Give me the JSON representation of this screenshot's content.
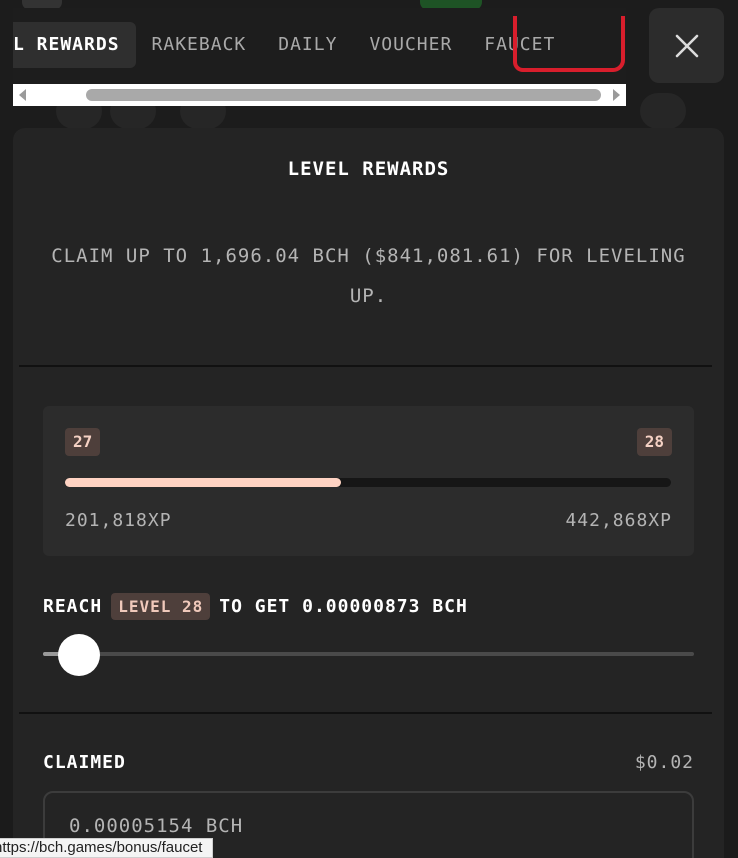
{
  "tabs": [
    {
      "label": "L REWARDS",
      "active": true
    },
    {
      "label": "RAKEBACK",
      "active": false
    },
    {
      "label": "DAILY",
      "active": false
    },
    {
      "label": "VOUCHER",
      "active": false
    },
    {
      "label": "FAUCET",
      "active": false
    }
  ],
  "close_icon": "close-icon",
  "panel": {
    "title": "LEVEL REWARDS",
    "description": "CLAIM UP TO 1,696.04 BCH ($841,081.61) FOR LEVELING UP."
  },
  "progress": {
    "current_level": "27",
    "next_level": "28",
    "current_xp": "201,818XP",
    "next_xp": "442,868XP",
    "fill_percent": 45.6
  },
  "reach": {
    "prefix": "REACH",
    "level_badge": "LEVEL 28",
    "suffix": "TO GET 0.00000873 BCH",
    "slider_percent": 5.5
  },
  "claimed": {
    "label": "CLAIMED",
    "usd": "$0.02",
    "amount": "0.00005154 BCH"
  },
  "status_url": "https://bch.games/bonus/faucet",
  "colors": {
    "accent": "#ffd3c3",
    "badge_bg": "#4e3f3b",
    "annotation_red": "#d81e2c",
    "panel_bg": "#242424"
  }
}
